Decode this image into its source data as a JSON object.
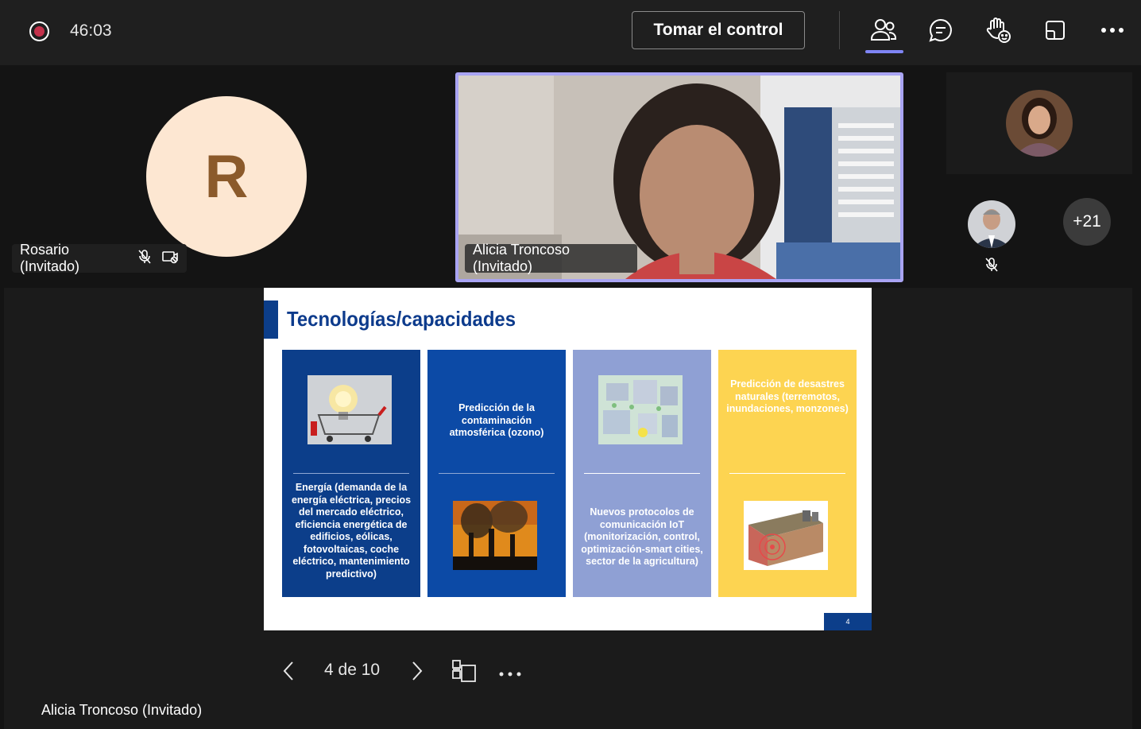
{
  "topbar": {
    "timer": "46:03",
    "take_control_label": "Tomar el control",
    "icons": [
      "record-icon",
      "people-icon",
      "chat-icon",
      "raise-hand-icon",
      "share-tray-icon",
      "more-icon"
    ]
  },
  "participants": {
    "rosario": {
      "initial": "R",
      "name": "Rosario (Invitado)"
    },
    "alicia": {
      "name": "Alicia Troncoso (Invitado)"
    },
    "overflow_count": "+21"
  },
  "slide": {
    "title": "Tecnologías/capacidades",
    "columns": [
      {
        "text": "Energía (demanda de la energía eléctrica, precios del mercado eléctrico, eficiencia energética de edificios, eólicas, fotovoltaicas, coche eléctrico, mantenimiento predictivo)",
        "color": "#0c3e8a"
      },
      {
        "text": "Predicción de la contaminación atmosférica (ozono)",
        "color": "#0c4aa6"
      },
      {
        "text": "Nuevos protocolos de comunicación IoT (monitorización, control, optimización-smart cities, sector de la agricultura)",
        "color": "#8fa0d4"
      },
      {
        "text": "Predicción de desastres naturales (terremotos, inundaciones, monzones)",
        "color": "#fdd451"
      }
    ],
    "page_number": "4"
  },
  "slide_nav": {
    "page_indicator": "4 de 10"
  },
  "presenter_name": "Alicia Troncoso (Invitado)"
}
